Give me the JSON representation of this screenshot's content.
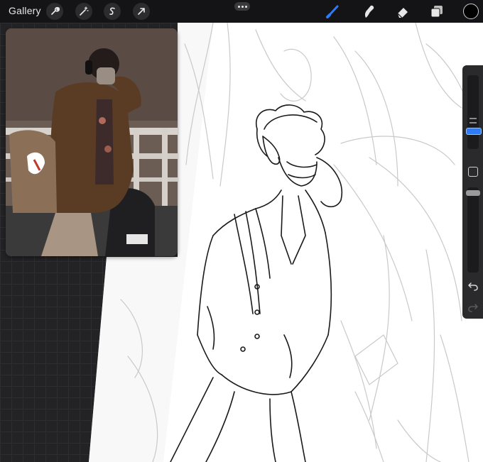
{
  "toolbar": {
    "gallery_label": "Gallery",
    "left_tools": [
      {
        "name": "wrench-icon"
      },
      {
        "name": "magic-wand-icon"
      },
      {
        "name": "selection-s-icon"
      },
      {
        "name": "transform-arrow-icon"
      }
    ],
    "more_menu": "more-dots-icon",
    "right_tools": [
      {
        "name": "brush-icon",
        "active": true
      },
      {
        "name": "smudge-icon",
        "active": false
      },
      {
        "name": "eraser-icon",
        "active": false
      },
      {
        "name": "layers-icon",
        "active": false
      }
    ],
    "current_color": "#000000",
    "accent_color": "#2f7bf6"
  },
  "reference": {
    "label": "reference-photo"
  },
  "sidebar": {
    "brush_size_level": 0.55,
    "brush_opacity_level": 0.92,
    "undo": "undo-icon",
    "redo": "redo-icon"
  }
}
